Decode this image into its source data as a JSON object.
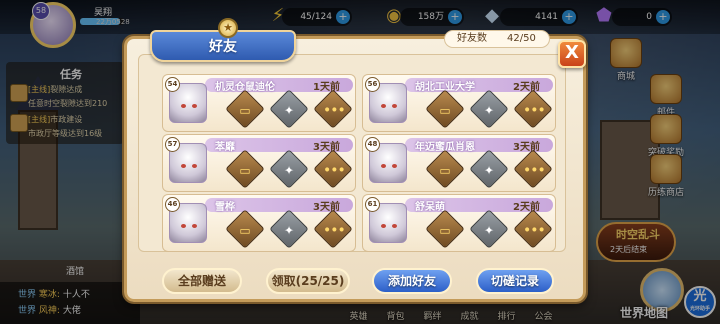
{
  "hud": {
    "player_level": "58",
    "player_name": "昊翔",
    "player_exp": "22万0528",
    "stamina": "45/124",
    "gold": "158万",
    "diamonds": "4141",
    "crystals": "0",
    "icons": {
      "stamina": "lightning-icon",
      "gold": "coin-icon",
      "diamond": "diamond-icon",
      "crystal": "crystal-icon"
    }
  },
  "quest": {
    "title": "任务",
    "lines": [
      {
        "tag": "[主线]",
        "text": "裂隙达成"
      },
      {
        "tag": "",
        "text": "任意时空裂隙达到210"
      },
      {
        "tag": "[主线]",
        "text": "市政建设"
      },
      {
        "tag": "",
        "text": "市政厅等级达到16级"
      }
    ]
  },
  "chat": {
    "lines": [
      {
        "channel": "世界",
        "name": "寒冰:",
        "text": "十人不"
      },
      {
        "channel": "世界",
        "name": "风神:",
        "text": "大佬"
      }
    ],
    "location": "酒馆"
  },
  "side_menu": [
    {
      "label": "商城",
      "icon": "shop-icon"
    },
    {
      "label": "邮件",
      "icon": "mail-icon"
    },
    {
      "label": "突破奖励",
      "icon": "reward-icon"
    },
    {
      "label": "历练商店",
      "icon": "store-icon"
    }
  ],
  "event": {
    "title": "时空乱斗",
    "subtitle": "2天后结束"
  },
  "map_label": "世界地图",
  "float_ball": {
    "glyph": "光",
    "sub": "光环助手"
  },
  "bottom_nav": [
    "英雄",
    "背包",
    "羁绊",
    "成就",
    "排行",
    "公会"
  ],
  "dialog": {
    "title": "好友",
    "count_label": "好友数",
    "count_value": "42/50",
    "close_glyph": "X",
    "friends": [
      {
        "level": "54",
        "name": "机灵仓鼠迪伦",
        "last_online": "1天前"
      },
      {
        "level": "56",
        "name": "胡北工业大学",
        "last_online": "2天前"
      },
      {
        "level": "57",
        "name": "苯靡",
        "last_online": "3天前"
      },
      {
        "level": "48",
        "name": "年迈蜜瓜肖恩",
        "last_online": "3天前"
      },
      {
        "level": "46",
        "name": "雪桦",
        "last_online": "3天前"
      },
      {
        "level": "61",
        "name": "舒呆萌",
        "last_online": "2天前"
      }
    ],
    "actions": {
      "chat": "chat-icon",
      "gift": "gift-icon",
      "more": "more-icon"
    },
    "buttons": {
      "gift_all": "全部赠送",
      "claim": "领取(25/25)",
      "add_friend": "添加好友",
      "spar_log": "切磋记录"
    }
  },
  "colors": {
    "accent_blue": "#2f5bb0",
    "close_orange": "#c9421a",
    "panel_bg": "#f3e8d2"
  }
}
